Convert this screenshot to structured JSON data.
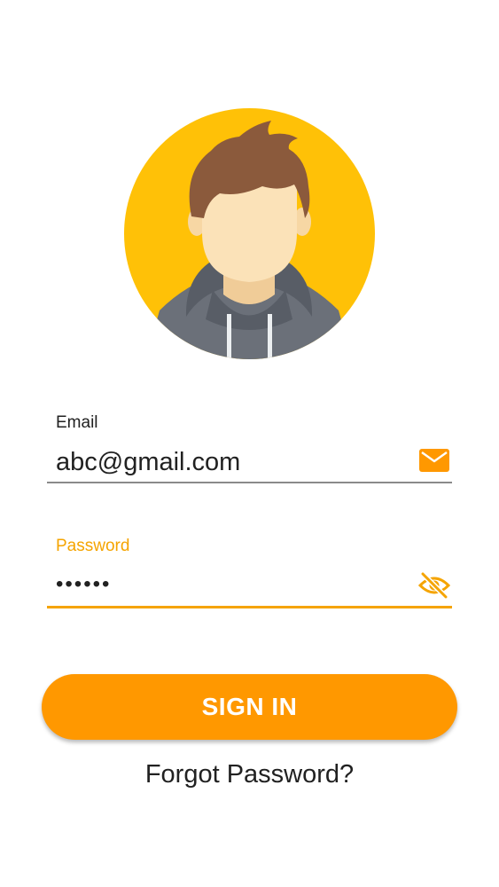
{
  "avatar": {
    "icon": "user-avatar-icon",
    "background_color": "#ffc107",
    "hair_color": "#8b5a3c",
    "skin_color": "#fbe2b8",
    "hoodie_color": "#6b7079"
  },
  "form": {
    "email": {
      "label": "Email",
      "value": "abc@gmail.com",
      "icon": "mail-icon"
    },
    "password": {
      "label": "Password",
      "value": "••••••",
      "icon": "visibility-off-icon"
    },
    "sign_in_label": "SIGN IN",
    "forgot_label": "Forgot Password?"
  },
  "colors": {
    "accent": "#ff9800",
    "accent_dark": "#f5a400",
    "text": "#212121",
    "underline_inactive": "#8a8a8a"
  }
}
